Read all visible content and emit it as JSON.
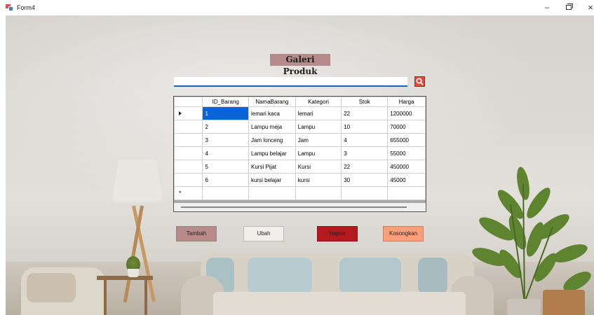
{
  "window": {
    "title": "Form4",
    "minimize": "–",
    "close": "×"
  },
  "heading": "Galeri Produk",
  "search": {
    "value": "",
    "placeholder": ""
  },
  "grid": {
    "columns": [
      "ID_Barang",
      "NamaBarang",
      "Kategori",
      "Stok",
      "Harga"
    ],
    "rows": [
      [
        "1",
        "lemari kaca",
        "lemari",
        "22",
        "1200000"
      ],
      [
        "2",
        "Lampu meja",
        "Lampu",
        "10",
        "70000"
      ],
      [
        "3",
        "Jam lonceng",
        "Jam",
        "4",
        "655000"
      ],
      [
        "4",
        "Lampu belajar",
        "Lampu",
        "3",
        "55000"
      ],
      [
        "5",
        "Kursi Pijat",
        "Kursi",
        "22",
        "450000"
      ],
      [
        "6",
        "kursi belajar",
        "kursi",
        "30",
        "45000"
      ]
    ],
    "new_row_marker": "*"
  },
  "buttons": {
    "tambah": "Tambah",
    "ubah": "Ubah",
    "hapus": "Hapus",
    "kosongkan": "Kosongkan"
  },
  "colors": {
    "heading_bg": "#b58b8b",
    "search_btn": "#e04a3a",
    "selection": "#0a64d8",
    "tambah": "#b88a8a",
    "ubah": "#f1efec",
    "hapus": "#b3191e",
    "kosongkan": "#f9a07a"
  }
}
